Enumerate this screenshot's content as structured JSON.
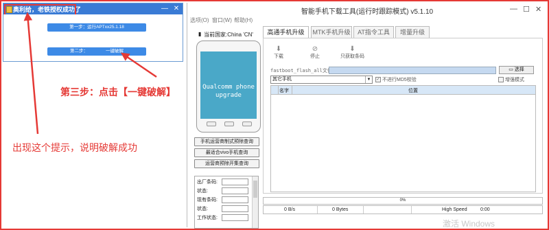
{
  "left_window": {
    "title": "奥利给，老铁授权成功了",
    "step1": "第一步：运行APTxx25.1.18",
    "step2_prefix": "第二步：",
    "step2_action": "一键破解"
  },
  "annotations": {
    "step3": "第三步：点击【一键破解】",
    "success": "出现这个提示，说明破解成功"
  },
  "main_window": {
    "title": "智能手机下载工具(运行时跟踪模式)  v5.1.10",
    "menu": [
      "选项(O)",
      "窗口(W)",
      "帮助(H)"
    ],
    "country_label": "当前国家:China 'CN'",
    "phone_screen": [
      "Qualcomm phone",
      "upgrade"
    ],
    "side_buttons": [
      "手机运营商制式预除查询",
      "最适合vivo手机查询",
      "运营商预除开集查询"
    ],
    "info_labels": [
      "出厂条码:",
      "状态:",
      "现有条码:",
      "状态:",
      "工作状态:"
    ],
    "tabs": [
      "高通手机升级",
      "MTK手机升级",
      "AT指令工具",
      "增量升级"
    ],
    "tools": [
      {
        "icon": "download-icon",
        "glyph": "⬇",
        "label": "下载"
      },
      {
        "icon": "stop-icon",
        "glyph": "⊘",
        "label": "停止"
      },
      {
        "icon": "read-barcode-icon",
        "glyph": "⬇",
        "label": "只获取条码"
      }
    ],
    "flash_label": "fastboot_flash_all文件",
    "flash_value": "",
    "select_button": "选择",
    "phone_type": "其它手机",
    "checkbox_md5": {
      "label": "不进行MD5校验",
      "checked": true
    },
    "checkbox_enhance": {
      "label": "增强模式",
      "checked": false
    },
    "table_headers": [
      "名字",
      "位置"
    ],
    "progress": {
      "value": 0,
      "text": "0%"
    },
    "status": {
      "speed": "0 B/s",
      "bytes": "0 Bytes",
      "mode": "High Speed",
      "time": "0:00"
    }
  },
  "watermark": "激活 Windows"
}
